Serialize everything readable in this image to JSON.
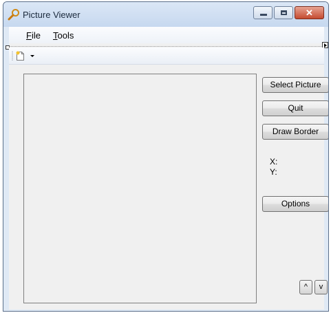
{
  "window": {
    "title": "Picture Viewer"
  },
  "titlebar": {
    "icons": [
      "magnifier-icon",
      "minimize-icon",
      "maximize-icon",
      "close-icon"
    ],
    "close_glyph": "✕"
  },
  "menu": {
    "file_accel": "F",
    "file_rest": "ile",
    "tools_accel": "T",
    "tools_rest": "ools"
  },
  "toolbar": {
    "icons": [
      "new-document-icon",
      "dropdown-arrow-icon"
    ]
  },
  "buttons": {
    "select_picture": "Select Picture",
    "quit": "Quit",
    "draw_border": "Draw Border",
    "options": "Options",
    "up": "^",
    "down": "v"
  },
  "coordinates": {
    "x_label": "X:",
    "y_label": "Y:"
  },
  "colors": {
    "window_frame": "#dfe9f5",
    "client_bg": "#f0f0f0",
    "close_button": "#c44a2f"
  }
}
